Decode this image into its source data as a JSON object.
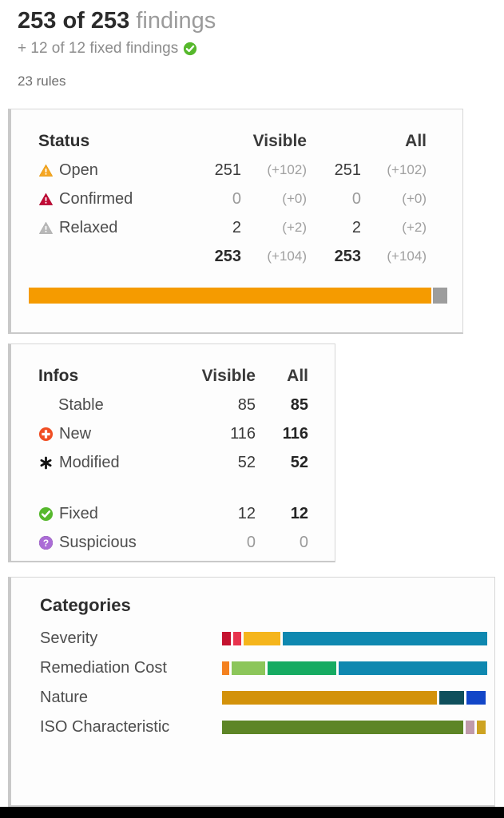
{
  "header": {
    "count_strong": "253 of 253",
    "count_suffix": " findings",
    "fixed_line": "+ 12 of 12 fixed findings",
    "fixed_icon": "check-circle-icon",
    "rules": "23 rules"
  },
  "status_panel": {
    "title": "Status",
    "col_visible": "Visible",
    "col_all": "All",
    "rows": [
      {
        "icon": "warning-triangle-orange-icon",
        "label": "Open",
        "visible": "251",
        "visible_delta": "(+102)",
        "all": "251",
        "all_delta": "(+102)",
        "zero": false
      },
      {
        "icon": "warning-triangle-red-icon",
        "label": "Confirmed",
        "visible": "0",
        "visible_delta": "(+0)",
        "all": "0",
        "all_delta": "(+0)",
        "zero": true
      },
      {
        "icon": "warning-triangle-gray-icon",
        "label": "Relaxed",
        "visible": "2",
        "visible_delta": "(+2)",
        "all": "2",
        "all_delta": "(+2)",
        "zero": false
      }
    ],
    "total": {
      "label": "",
      "visible": "253",
      "visible_delta": "(+104)",
      "all": "253",
      "all_delta": "(+104)"
    },
    "progress": {
      "segments": [
        {
          "name": "open",
          "color": "#f59b00",
          "pct": 96.5
        },
        {
          "name": "relaxed",
          "color": "#9d9d9d",
          "pct": 3.5
        }
      ]
    }
  },
  "infos_panel": {
    "title": "Infos",
    "col_visible": "Visible",
    "col_all": "All",
    "rows": [
      {
        "icon": "",
        "label": "Stable",
        "visible": "85",
        "all": "85",
        "zero": false
      },
      {
        "icon": "new-plus-circle-icon",
        "label": "New",
        "visible": "116",
        "all": "116",
        "zero": false
      },
      {
        "icon": "modified-asterisk-icon",
        "label": "Modified",
        "visible": "52",
        "all": "52",
        "zero": false
      }
    ],
    "rows2": [
      {
        "icon": "fixed-check-circle-icon",
        "label": "Fixed",
        "visible": "12",
        "all": "12",
        "zero": false
      },
      {
        "icon": "suspicious-question-icon",
        "label": "Suspicious",
        "visible": "0",
        "all": "0",
        "zero": true
      }
    ]
  },
  "categories_panel": {
    "title": "Categories",
    "rows": [
      {
        "name": "Severity",
        "segments": [
          {
            "color": "#c4122f",
            "pct": 3.2
          },
          {
            "color": "#e8344e",
            "pct": 3.2
          },
          {
            "color": "#f5b51c",
            "pct": 13.8
          },
          {
            "color": "#0f88b0",
            "pct": 77.0
          }
        ]
      },
      {
        "name": "Remediation Cost",
        "segments": [
          {
            "color": "#f4811f",
            "pct": 2.6
          },
          {
            "color": "#8cc65a",
            "pct": 12.9
          },
          {
            "color": "#16ab62",
            "pct": 25.7
          },
          {
            "color": "#0f88b0",
            "pct": 56.0
          }
        ]
      },
      {
        "name": "Nature",
        "segments": [
          {
            "color": "#d3920b",
            "pct": 81.0
          },
          {
            "color": "#0f4f5c",
            "pct": 9.5
          },
          {
            "color": "#1246c8",
            "pct": 7.0
          }
        ]
      },
      {
        "name": "ISO Characteristic",
        "segments": [
          {
            "color": "#5d8526",
            "pct": 91.0
          },
          {
            "color": "#c09aab",
            "pct": 3.2
          },
          {
            "color": "#cda322",
            "pct": 3.4
          }
        ]
      }
    ]
  }
}
